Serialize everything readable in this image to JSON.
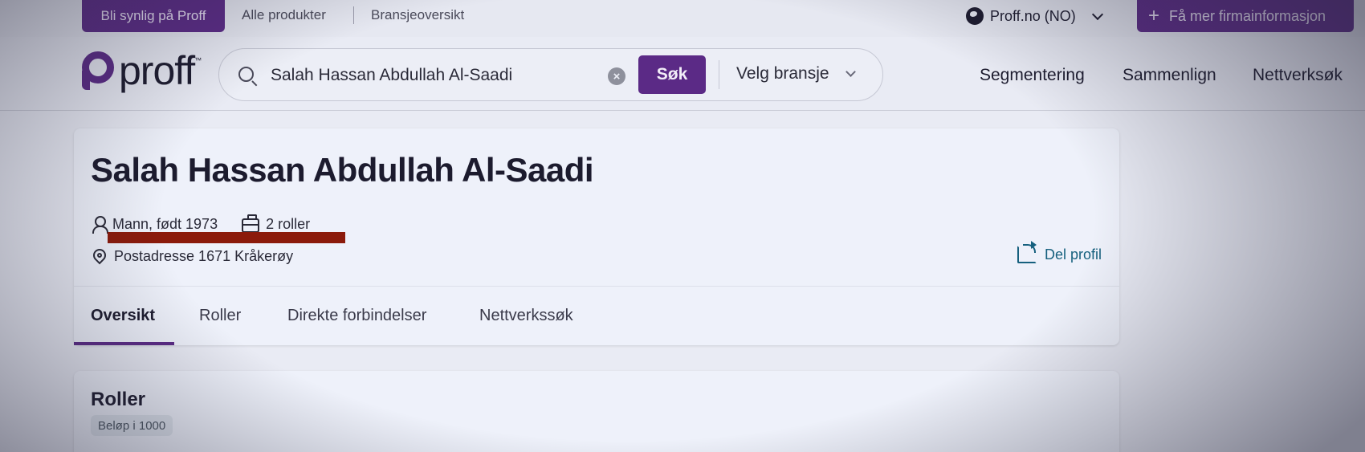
{
  "topbar": {
    "visible_button": "Bli synlig på Proff",
    "links": [
      "Alle produkter",
      "Bransjeoversikt"
    ],
    "locale": "Proff.no (NO)",
    "more_button": "Få mer firmainformasjon"
  },
  "header": {
    "logo_text": "proff",
    "logo_tm": "™",
    "search": {
      "value": "Salah Hassan Abdullah Al-Saadi",
      "clear_icon": "×",
      "button": "Søk"
    },
    "industry_select": "Velg bransje",
    "nav": [
      "Segmentering",
      "Sammenlign",
      "Nettverksøk"
    ]
  },
  "profile": {
    "name": "Salah Hassan Abdullah Al-Saadi",
    "gender_born": "Mann, født 1973",
    "roles": "2 roller",
    "address": "Postadresse 1671 Kråkerøy",
    "share": "Del profil",
    "tabs": [
      "Oversikt",
      "Roller",
      "Direkte forbindelser",
      "Nettverkssøk"
    ],
    "active_tab": "Oversikt"
  },
  "roles_section": {
    "title": "Roller",
    "chip": "Beløp i 1000"
  },
  "colors": {
    "brand": "#5b2a86",
    "link": "#16607e",
    "redaction": "#8b1a0b"
  }
}
